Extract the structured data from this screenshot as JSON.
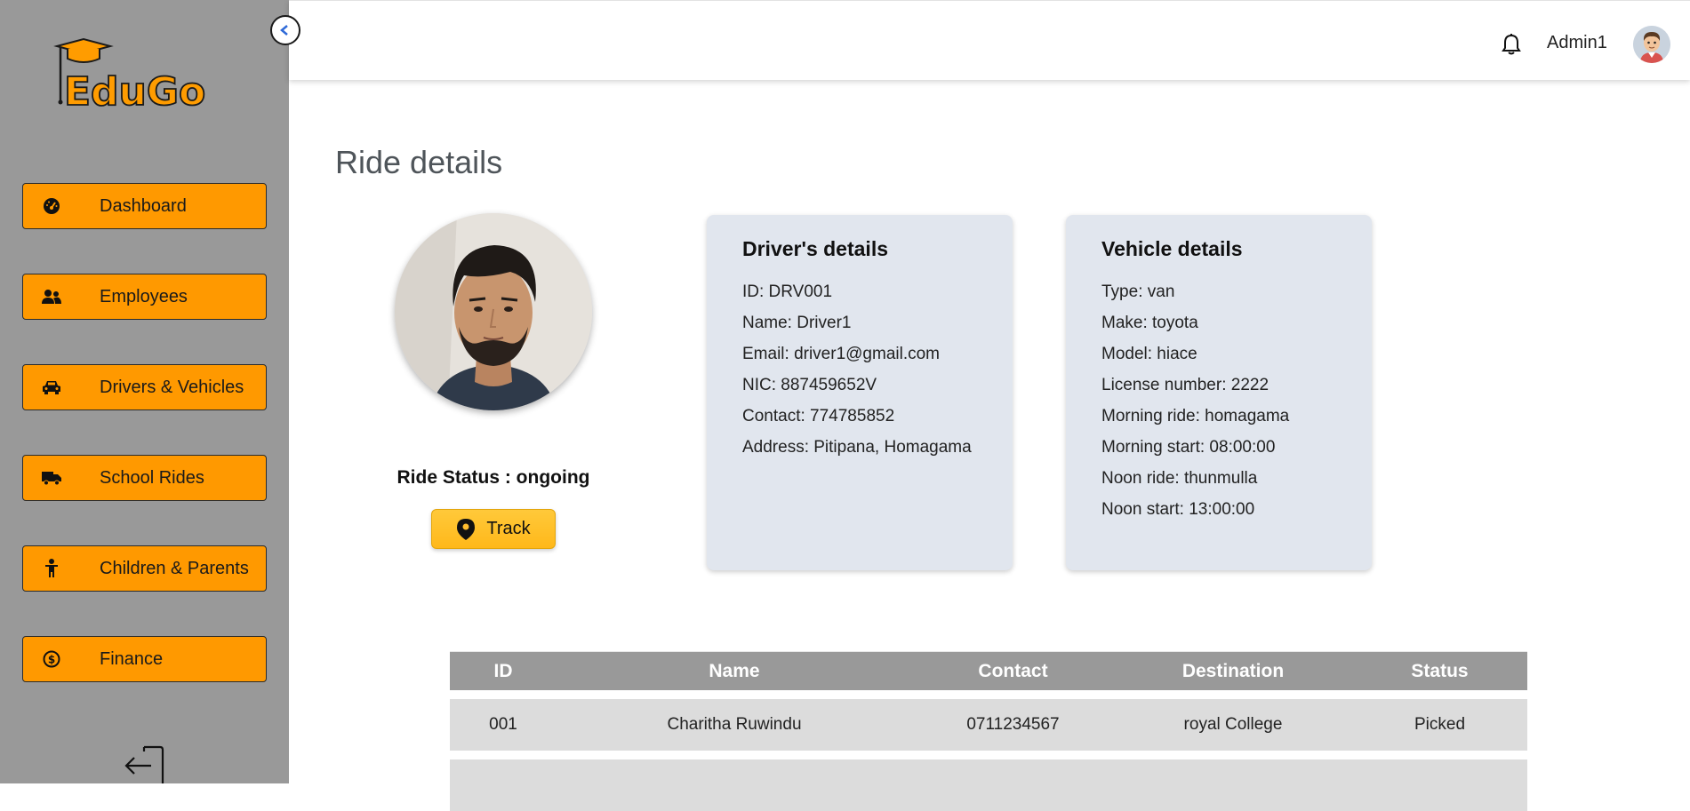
{
  "app": {
    "name": "EduGo"
  },
  "sidebar": {
    "items": [
      {
        "label": "Dashboard",
        "icon": "gauge-icon"
      },
      {
        "label": "Employees",
        "icon": "users-icon"
      },
      {
        "label": "Drivers & Vehicles",
        "icon": "car-icon"
      },
      {
        "label": "School Rides",
        "icon": "truck-icon"
      },
      {
        "label": "Children & Parents",
        "icon": "child-icon"
      },
      {
        "label": "Finance",
        "icon": "coin-icon"
      }
    ]
  },
  "header": {
    "user_name": "Admin1"
  },
  "page": {
    "title": "Ride details"
  },
  "ride": {
    "status_text": "Ride Status : ongoing",
    "track_label": "Track"
  },
  "driver_card": {
    "title": "Driver's details",
    "rows": [
      "ID: DRV001",
      "Name: Driver1",
      "Email: driver1@gmail.com",
      "NIC: 887459652V",
      "Contact: 774785852",
      "Address: Pitipana, Homagama"
    ]
  },
  "vehicle_card": {
    "title": "Vehicle details",
    "rows": [
      "Type: van",
      "Make: toyota",
      "Model: hiace",
      "License number: 2222",
      "Morning ride: homagama",
      "Morning start: 08:00:00",
      "Noon ride: thunmulla",
      "Noon start: 13:00:00"
    ]
  },
  "table": {
    "headers": [
      "ID",
      "Name",
      "Contact",
      "Destination",
      "Status"
    ],
    "rows": [
      [
        "001",
        "Charitha Ruwindu",
        "0711234567",
        "royal College",
        "Picked"
      ]
    ]
  },
  "colors": {
    "sidebar_bg": "#999999",
    "nav_button": "#ff9900",
    "track_button": "#ffbd2e",
    "card_bg": "#e1e6ee",
    "table_header": "#999999",
    "table_row": "#dcdcdc"
  }
}
